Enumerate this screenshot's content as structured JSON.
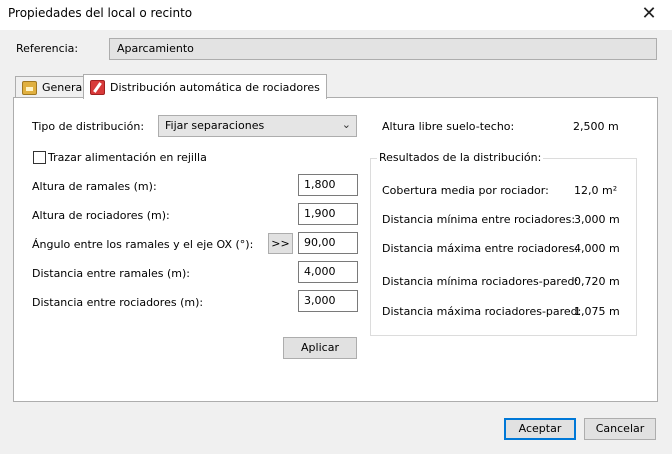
{
  "window": {
    "title": "Propiedades del local o recinto",
    "close_glyph": "✕"
  },
  "reference": {
    "label": "Referencia:",
    "value": "Aparcamiento"
  },
  "tabs": [
    {
      "label": "General",
      "icon": "folder-icon"
    },
    {
      "label": "Distribución automática de rociadores",
      "icon": "sprinkler-pencil-icon"
    }
  ],
  "form": {
    "distribution_type_label": "Tipo de distribución:",
    "distribution_type_value": "Fijar separaciones",
    "grid_feed_label": "Trazar alimentación en rejilla",
    "fields": [
      {
        "label": "Altura de ramales (m):",
        "value": "1,800"
      },
      {
        "label": "Altura de rociadores (m):",
        "value": "1,900"
      },
      {
        "label": "Ángulo entre los ramales y el eje OX (°):",
        "value": "90,00",
        "button": ">>"
      },
      {
        "label": "Distancia entre ramales (m):",
        "value": "4,000"
      },
      {
        "label": "Distancia entre rociadores (m):",
        "value": "3,000"
      }
    ],
    "apply_label": "Aplicar"
  },
  "info": {
    "clear_height_label": "Altura libre suelo-techo:",
    "clear_height_value": "2,500 m",
    "results_title": "Resultados de la distribución:",
    "results": [
      {
        "label": "Cobertura media por rociador:",
        "value": "12,0 m²"
      },
      {
        "label": "Distancia mínima entre rociadores:",
        "value": "3,000 m"
      },
      {
        "label": "Distancia máxima entre rociadores:",
        "value": "4,000 m"
      },
      {
        "label": "Distancia mínima rociadores-pared:",
        "value": "0,720 m"
      },
      {
        "label": "Distancia máxima rociadores-pared:",
        "value": "1,075 m"
      }
    ]
  },
  "footer": {
    "accept_label": "Aceptar",
    "cancel_label": "Cancelar"
  }
}
